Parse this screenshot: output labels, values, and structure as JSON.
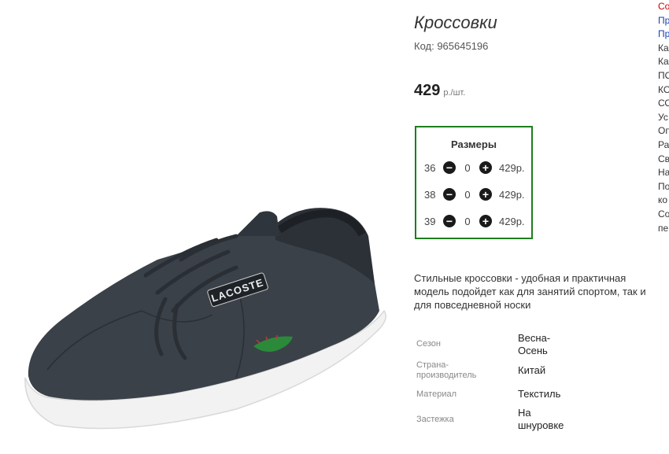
{
  "product": {
    "title": "Кроссовки",
    "code": "Код: 965645196",
    "price": "429",
    "price_unit": "р./шт.",
    "image_logo_text": "LACOSTE",
    "description": "Стильные кроссовки - удобная и практичная модель подойдет как для занятий спортом, так и для повседневной носки"
  },
  "sizes": {
    "title": "Размеры",
    "rows": [
      {
        "size": "36",
        "minus": "−",
        "qty": "0",
        "plus": "+",
        "price": "429р."
      },
      {
        "size": "38",
        "minus": "−",
        "qty": "0",
        "plus": "+",
        "price": "429р."
      },
      {
        "size": "39",
        "minus": "−",
        "qty": "0",
        "plus": "+",
        "price": "429р."
      }
    ]
  },
  "attributes": [
    {
      "label": "Сезон",
      "value": "Весна-\nОсень"
    },
    {
      "label": "Страна-\nпроизводитель",
      "value": "Китай"
    },
    {
      "label": "Материал",
      "value": "Текстиль"
    },
    {
      "label": "Застежка",
      "value": "На\nшнуровке"
    }
  ],
  "right_column": {
    "lines": [
      "Со",
      "Пр",
      "Пр",
      "Ка",
      "Ка",
      "ПО",
      "КО",
      "СО",
      "Ус",
      "Оп",
      "Ра",
      "Св",
      "На",
      "По",
      "ко",
      "Со",
      "пе"
    ],
    "colors": [
      "#cc0000",
      "#1a3fb0",
      "#1a3fb0",
      "#333333",
      "#333333",
      "#333333",
      "#333333",
      "#333333",
      "#333333",
      "#333333",
      "#333333",
      "#333333",
      "#333333",
      "#333333",
      "#333333",
      "#333333",
      "#333333"
    ]
  },
  "colors": {
    "size_box_border": "#1e7d1e",
    "shoe": "#3b4149",
    "sole": "#f2f2f2",
    "croc": "#2a8a3a"
  }
}
